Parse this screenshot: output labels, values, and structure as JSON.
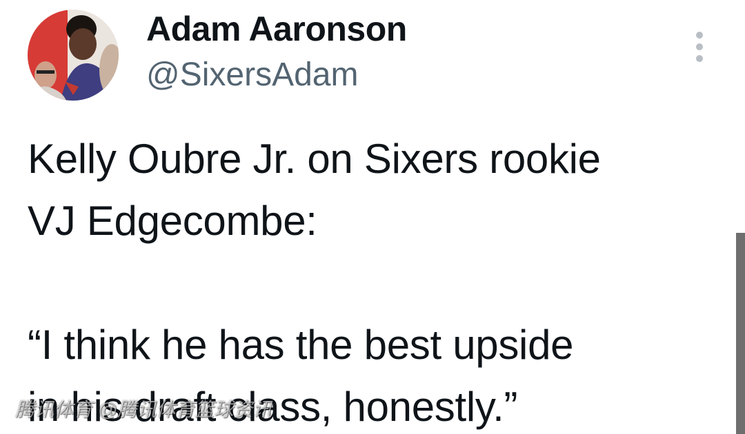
{
  "tweet": {
    "author_name": "Adam Aaronson",
    "author_handle": "@SixersAdam",
    "text": "Kelly Oubre Jr. on Sixers rookie\nVJ Edgecombe:\n\n“I think he has the best upside\nin his draft class, honestly.”",
    "more_icon": "more-vertical-icon"
  },
  "watermark": {
    "text": "腾讯体育 @腾讯体育篮球资讯"
  },
  "colors": {
    "text": "#0f1419",
    "secondary_text": "#536471",
    "more_icon": "#b8bec4",
    "scrollbar": "#6e6e6e"
  }
}
